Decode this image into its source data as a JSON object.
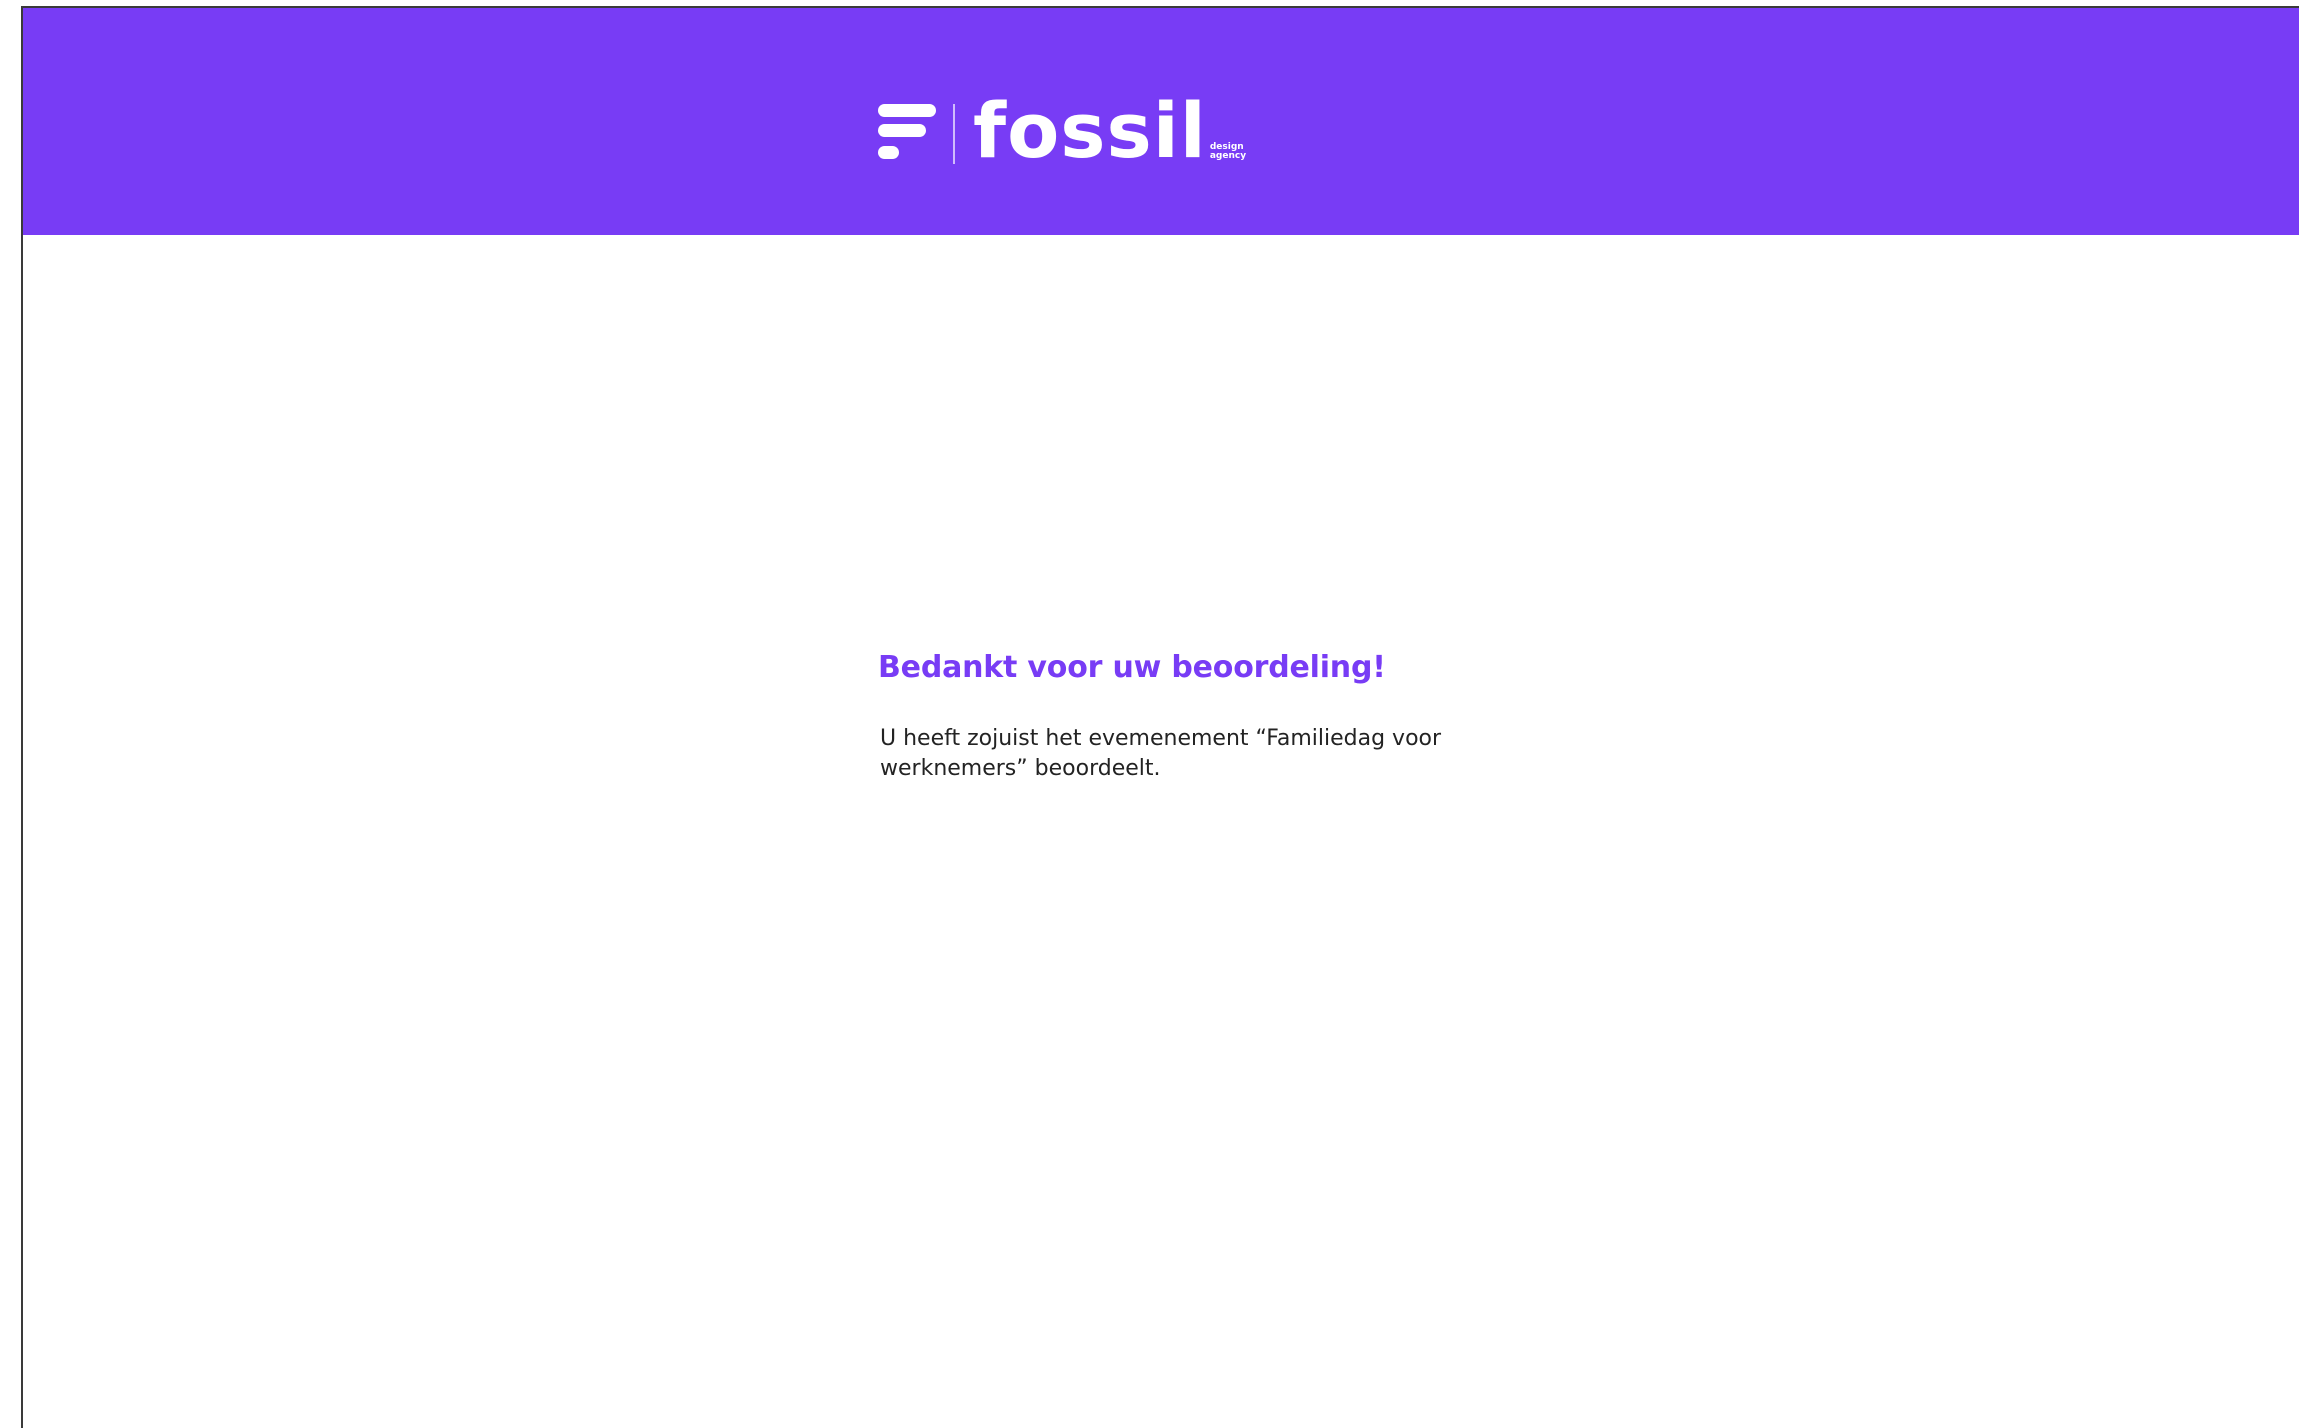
{
  "header": {
    "background_color": "#783cf5",
    "logo": {
      "icon": "fossil-f-logo-icon",
      "wordmark": "fossil",
      "tagline_line1": "design",
      "tagline_line2": "agency"
    }
  },
  "confirmation": {
    "title": "Bedankt voor uw beoordeling!",
    "message": "U heeft zojuist het evemenement “Familiedag voor werknemers” beoordeelt.",
    "title_color": "#783cf5",
    "text_color": "#232323"
  }
}
